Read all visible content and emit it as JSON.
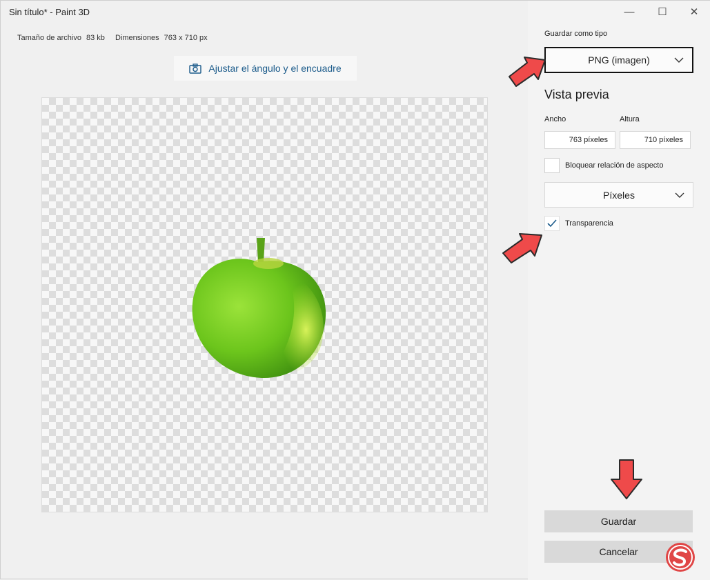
{
  "window": {
    "title": "Sin título* - Paint 3D",
    "minimize_glyph": "—",
    "maximize_glyph": "☐",
    "close_glyph": "✕"
  },
  "file_info": {
    "size_label": "Tamaño de archivo",
    "size_value": "83 kb",
    "dimensions_label": "Dimensiones",
    "dimensions_value": "763 x 710 px"
  },
  "crop_button": {
    "label": "Ajustar el ángulo y el encuadre",
    "icon": "camera-icon"
  },
  "save_panel": {
    "save_type_label": "Guardar como tipo",
    "save_type_value": "PNG (imagen)",
    "preview_heading": "Vista previa",
    "width_label": "Ancho",
    "height_label": "Altura",
    "width_value": "763 píxeles",
    "height_value": "710 píxeles",
    "lock_aspect_label": "Bloquear relación de aspecto",
    "lock_aspect_checked": false,
    "units_value": "Píxeles",
    "transparency_label": "Transparencia",
    "transparency_checked": true,
    "save_label": "Guardar",
    "cancel_label": "Cancelar"
  },
  "colors": {
    "accent_text": "#1a5a8a",
    "annotation_arrow": "#ef4a4a",
    "apple_green": "#7ed321"
  }
}
